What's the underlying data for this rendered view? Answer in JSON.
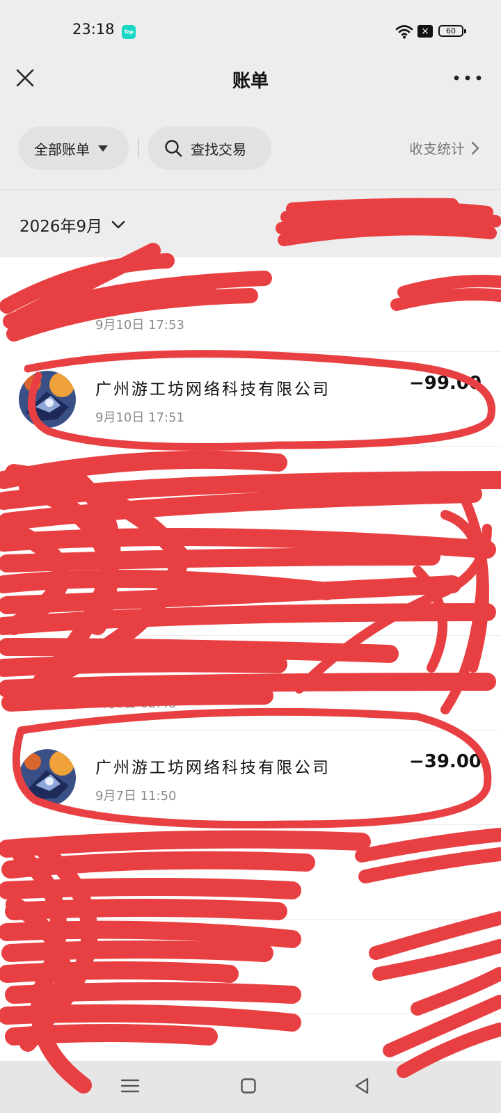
{
  "status_bar": {
    "time": "23:18",
    "app_badge": "Tap",
    "battery": "60",
    "sim_icon": "sim-x-icon"
  },
  "header": {
    "title": "账单",
    "close_icon": "close-icon",
    "more_icon": "more-icon"
  },
  "filters": {
    "all_bills": "全部账单",
    "search": "查找交易",
    "stats": "收支统计"
  },
  "month": {
    "label": "2026年9月"
  },
  "transactions": [
    {
      "name": "",
      "date": "9月10日 17:53",
      "amount": ""
    },
    {
      "name": "广州游工坊网络科技有限公司",
      "date": "9月10日 17:51",
      "amount": "−99.00"
    },
    {
      "name": "",
      "date": "",
      "amount": ""
    },
    {
      "name": "",
      "date": "",
      "amount": ""
    },
    {
      "name": "",
      "date": "9月8日 02:48",
      "amount": ""
    },
    {
      "name": "广州游工坊网络科技有限公司",
      "date": "9月7日 11:50",
      "amount": "−39.00"
    },
    {
      "name": "",
      "date": "",
      "amount": ""
    },
    {
      "name": "",
      "date": "",
      "amount": ""
    }
  ],
  "colors": {
    "background": "#ededed",
    "list_background": "#ffffff",
    "redaction": "#e84042",
    "amount": "#111111",
    "secondary_text": "#8a8a8a"
  }
}
